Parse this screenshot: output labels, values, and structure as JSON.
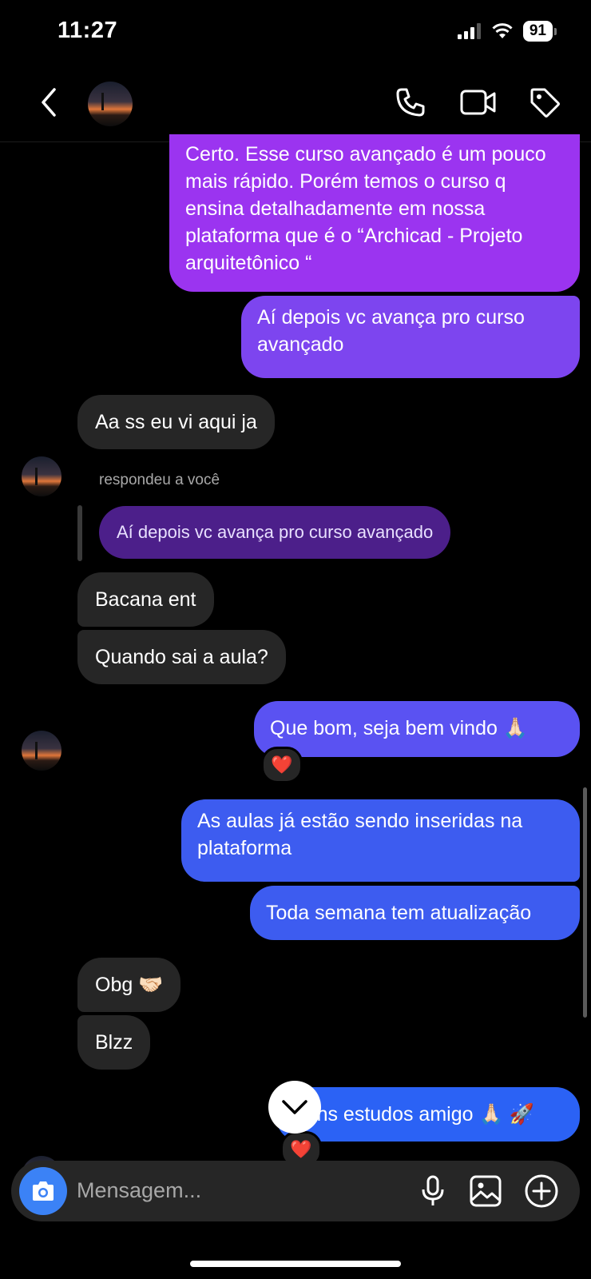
{
  "status_bar": {
    "time": "11:27",
    "battery": "91"
  },
  "header": {
    "back_icon": "chevron-left-icon",
    "call_icon": "phone-icon",
    "video_icon": "video-camera-icon",
    "tag_icon": "tag-icon"
  },
  "messages": {
    "m1": "Certo. Esse curso avançado é um pouco mais rápido. Porém temos o curso q ensina detalhadamente em nossa plataforma que é o “Archicad - Projeto arquitetônico “",
    "m2": "Aí depois vc avança pro curso avançado",
    "m3": "Aa ss eu vi aqui ja",
    "reply_label": "respondeu a você",
    "reply_quote": "Aí depois vc avança pro curso avançado",
    "m4": "Bacana ent",
    "m5": "Quando sai a aula?",
    "m6": "Que bom, seja bem vindo 🙏🏻",
    "m7": "As aulas já estão sendo inseridas na plataforma",
    "m8": "Toda semana tem atualização",
    "m9": "Obg 🤝🏻",
    "m10": "Blzz",
    "m11": "Bons estudos amigo 🙏🏻 🚀"
  },
  "reactions": {
    "r1": "❤️",
    "r2": "❤️"
  },
  "composer": {
    "placeholder": "Mensagem...",
    "icons": [
      "camera-icon",
      "microphone-icon",
      "gallery-icon",
      "plus-icon"
    ]
  },
  "colors": {
    "background": "#000000",
    "incoming": "#262626",
    "accent_purple": "#9b34f0",
    "accent_blue": "#2b62f5"
  }
}
